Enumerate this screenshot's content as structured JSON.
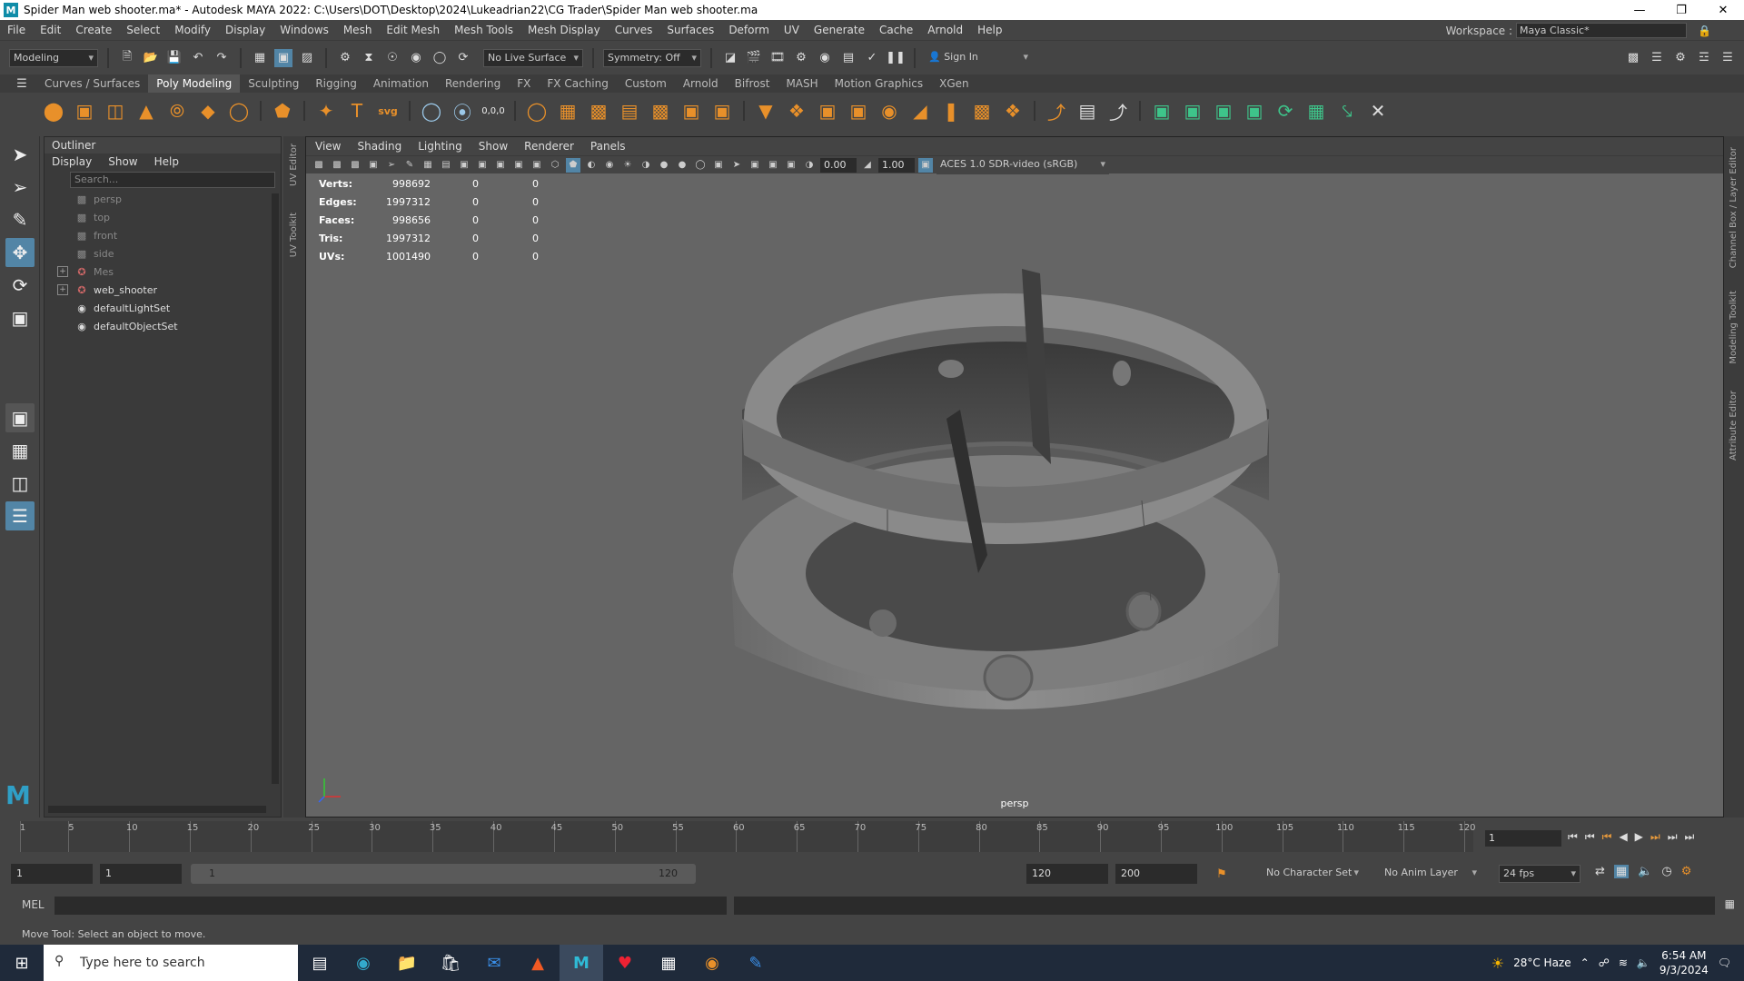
{
  "window": {
    "title": "Spider Man web shooter.ma* - Autodesk MAYA 2022: C:\\Users\\DOT\\Desktop\\2024\\Lukeadrian22\\CG Trader\\Spider Man web shooter.ma",
    "logo": "M"
  },
  "menu": [
    "File",
    "Edit",
    "Create",
    "Select",
    "Modify",
    "Display",
    "Windows",
    "Mesh",
    "Edit Mesh",
    "Mesh Tools",
    "Mesh Display",
    "Curves",
    "Surfaces",
    "Deform",
    "UV",
    "Generate",
    "Cache",
    "Arnold",
    "Help"
  ],
  "workspace": {
    "label": "Workspace :",
    "value": "Maya Classic*"
  },
  "status": {
    "mode": "Modeling",
    "live_surface": "No Live Surface",
    "symmetry": "Symmetry: Off",
    "sign_in": "Sign In"
  },
  "shelf_tabs": [
    "Curves / Surfaces",
    "Poly Modeling",
    "Sculpting",
    "Rigging",
    "Animation",
    "Rendering",
    "FX",
    "FX Caching",
    "Custom",
    "Arnold",
    "Bifrost",
    "MASH",
    "Motion Graphics",
    "XGen"
  ],
  "shelf_active": "Poly Modeling",
  "outliner": {
    "title": "Outliner",
    "menu": [
      "Display",
      "Show",
      "Help"
    ],
    "search_placeholder": "Search...",
    "items": [
      {
        "label": "persp",
        "dim": true
      },
      {
        "label": "top",
        "dim": true
      },
      {
        "label": "front",
        "dim": true
      },
      {
        "label": "side",
        "dim": true
      },
      {
        "label": "Mes",
        "dim": true
      },
      {
        "label": "web_shooter",
        "dim": false
      },
      {
        "label": "defaultLightSet",
        "dim": false
      },
      {
        "label": "defaultObjectSet",
        "dim": false
      }
    ]
  },
  "side_tabs": {
    "uv_editor": "UV Editor",
    "uv_toolkit": "UV Toolkit",
    "channel_box": "Channel Box / Layer Editor",
    "modeling_toolkit": "Modeling Toolkit",
    "attribute_editor": "Attribute Editor"
  },
  "viewport": {
    "menu": [
      "View",
      "Shading",
      "Lighting",
      "Show",
      "Renderer",
      "Panels"
    ],
    "exposure": "0.00",
    "gamma": "1.00",
    "color_space": "ACES 1.0 SDR-video (sRGB)",
    "camera": "persp",
    "hud": [
      {
        "label": "Verts:",
        "v1": "998692",
        "v2": "0",
        "v3": "0"
      },
      {
        "label": "Edges:",
        "v1": "1997312",
        "v2": "0",
        "v3": "0"
      },
      {
        "label": "Faces:",
        "v1": "998656",
        "v2": "0",
        "v3": "0"
      },
      {
        "label": "Tris:",
        "v1": "1997312",
        "v2": "0",
        "v3": "0"
      },
      {
        "label": "UVs:",
        "v1": "1001490",
        "v2": "0",
        "v3": "0"
      }
    ]
  },
  "timeline": {
    "ticks": [
      "1",
      "5",
      "10",
      "15",
      "20",
      "25",
      "30",
      "35",
      "40",
      "45",
      "50",
      "55",
      "60",
      "65",
      "70",
      "75",
      "80",
      "85",
      "90",
      "95",
      "100",
      "105",
      "110",
      "115",
      "120"
    ],
    "current_frame": "1"
  },
  "range": {
    "start": "1",
    "playback_start": "1",
    "slider_start": "1",
    "slider_end": "120",
    "playback_end": "120",
    "end": "200",
    "character_set": "No Character Set",
    "anim_layer": "No Anim Layer",
    "fps": "24 fps"
  },
  "mel": {
    "label": "MEL"
  },
  "help_line": "Move Tool: Select an object to move.",
  "taskbar": {
    "search": "Type here to search",
    "weather": "28°C  Haze",
    "time": "6:54 AM",
    "date": "9/3/2024"
  }
}
